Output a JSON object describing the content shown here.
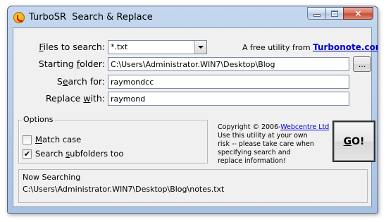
{
  "window": {
    "title": "TurboSR  Search & Replace",
    "app_icon": "turbosr-app-icon",
    "caption_buttons": {
      "minimize": "minimize-icon",
      "maximize": "maximize-icon",
      "close_label": "×"
    }
  },
  "form": {
    "files_label_access": "F",
    "files_label_rest": "iles to search:",
    "files_value": "*.txt",
    "starting_label_pre": "Starting ",
    "starting_label_access": "f",
    "starting_label_post": "older:",
    "starting_value": "C:\\Users\\Administrator.WIN7\\Desktop\\Blog",
    "browse_label": "...",
    "search_label_pre": "S",
    "search_label_access": "e",
    "search_label_post": "arch for:",
    "search_value": "raymondcc",
    "replace_label_pre": "Replace ",
    "replace_label_access": "w",
    "replace_label_post": "ith:",
    "replace_value": "raymond"
  },
  "utility": {
    "text": "A free utility from ",
    "link": "Turbonote.com"
  },
  "options": {
    "legend": "Options",
    "match_case_access": "M",
    "match_case_rest": "atch case",
    "match_case_checked": false,
    "subfolders_pre": "Search ",
    "subfolders_access": "s",
    "subfolders_post": "ubfolders too",
    "subfolders_checked": true,
    "checkmark": "✔"
  },
  "copyright": {
    "line1_pre": "Copyright © 2006-",
    "line1_link": "Webcentre Ltd",
    "line2": "Use this utility at your own",
    "line3": "risk -- please take care when",
    "line4": "specifying search and",
    "line5": "replace information!"
  },
  "go_button": {
    "access": "G",
    "rest": "O!"
  },
  "status": {
    "title": "Now Searching",
    "path": "C:\\Users\\Administrator.WIN7\\Desktop\\Blog\\notes.txt"
  },
  "colors": {
    "link": "#0000cc",
    "close_red": "#c84a33",
    "client_bg": "#f0f0f0"
  }
}
